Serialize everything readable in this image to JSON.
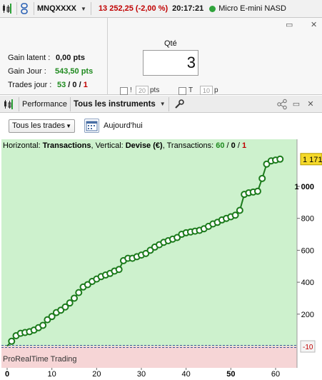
{
  "topbar": {
    "symbol": "MNQXXXX",
    "price_change": "13 252,25 (-2,00 %)",
    "time": "20:17:21",
    "instrument": "Micro E-mini NASD"
  },
  "panel": {
    "gain_latent_label": "Gain latent :",
    "gain_latent_value": "0,00 pts",
    "gain_jour_label": "Gain Jour :",
    "gain_jour_value": "543,50 pts",
    "trades_label": "Trades jour :",
    "trades_win": "53",
    "trades_zero": "0",
    "trades_loss": "1",
    "qte_label": "Qté",
    "qte_value": "3",
    "spin1": "20",
    "spin1_unit": "pts",
    "spin2": "10",
    "spin2_unit": "p",
    "chk1_label": "!",
    "chk2_label": "T"
  },
  "perfbar": {
    "performance_label": "Performance",
    "instruments_label": "Tous les instruments"
  },
  "filter": {
    "trades_select": "Tous les trades",
    "date_label": "Aujourd'hui"
  },
  "chart_data": {
    "type": "line",
    "info": {
      "horizontal_label": "Horizontal:",
      "horizontal_value": "Transactions",
      "vertical_label": "Vertical:",
      "vertical_value": "Devise (€)",
      "transactions_label": "Transactions:",
      "win": "60",
      "zero": "0",
      "loss": "1"
    },
    "watermark": "ProRealTime Trading",
    "last_value_label": "1 171",
    "neg_label": "-10",
    "xlim": [
      0,
      64
    ],
    "ylim": [
      -30,
      1200
    ],
    "x_ticks": [
      "0",
      "10",
      "20",
      "30",
      "40",
      "50",
      "60"
    ],
    "y_ticks": [
      "200",
      "400",
      "600",
      "800",
      "1 000"
    ],
    "colors": {
      "line": "#1b7a1b",
      "positive_bg": "#cdf1cd",
      "negative_bg": "#f6d5d6",
      "label_bg": "#f5d92a"
    },
    "x": [
      1,
      2,
      3,
      4,
      5,
      6,
      7,
      8,
      9,
      10,
      11,
      12,
      13,
      14,
      15,
      16,
      17,
      18,
      19,
      20,
      21,
      22,
      23,
      24,
      25,
      26,
      27,
      28,
      29,
      30,
      31,
      32,
      33,
      34,
      35,
      36,
      37,
      38,
      39,
      40,
      41,
      42,
      43,
      44,
      45,
      46,
      47,
      48,
      49,
      50,
      51,
      52,
      53,
      54,
      55,
      56,
      57,
      58,
      59,
      60,
      61
    ],
    "values": [
      30,
      65,
      80,
      85,
      90,
      100,
      115,
      130,
      165,
      185,
      210,
      225,
      245,
      270,
      300,
      335,
      370,
      385,
      405,
      420,
      435,
      445,
      455,
      470,
      480,
      535,
      550,
      550,
      560,
      570,
      580,
      600,
      620,
      635,
      650,
      660,
      670,
      680,
      700,
      710,
      715,
      720,
      725,
      735,
      750,
      765,
      775,
      790,
      800,
      810,
      820,
      850,
      950,
      960,
      965,
      970,
      1050,
      1140,
      1160,
      1165,
      1171
    ]
  }
}
